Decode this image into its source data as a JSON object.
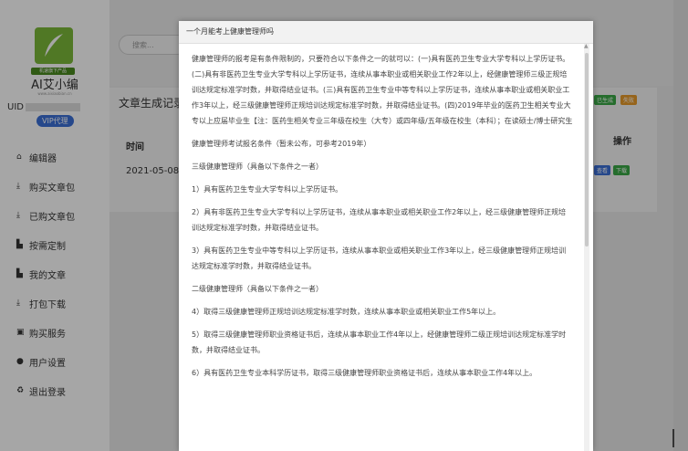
{
  "brand": {
    "name": "AI艾小编",
    "tagline": "机速旗下产品",
    "url": "www.aixiaobian.cn",
    "uid_label": "UID",
    "vip_badge": "VIP代理"
  },
  "search": {
    "placeholder": "搜索..."
  },
  "nav": [
    {
      "label": "编辑器",
      "icon": "home-icon"
    },
    {
      "label": "购买文章包",
      "icon": "download-icon"
    },
    {
      "label": "已购文章包",
      "icon": "download-icon"
    },
    {
      "label": "按需定制",
      "icon": "file-icon"
    },
    {
      "label": "我的文章",
      "icon": "file-icon"
    },
    {
      "label": "打包下载",
      "icon": "download-icon"
    },
    {
      "label": "购买服务",
      "icon": "service-icon"
    },
    {
      "label": "用户设置",
      "icon": "user-icon"
    },
    {
      "label": "退出登录",
      "icon": "logout-icon"
    }
  ],
  "records": {
    "title": "文章生成记录",
    "col_time": "时间",
    "col_ops": "操作",
    "row_time": "2021-05-08 18",
    "status_generated": "已生成",
    "status_failed": "失败",
    "view_label": "查看",
    "download_label": "下载"
  },
  "modal": {
    "title": "一个月能考上健康管理师吗",
    "paragraphs": [
      "健康管理师的报考是有条件限制的，只要符合以下条件之一的就可以：(一)具有医药卫生专业大学专科以上学历证书。(二)具有非医药卫生专业大学专科以上学历证书，连续从事本职业或相关职业工作2年以上，经健康管理师三级正规培训达规定标准学时数，并取得结业证书。(三)具有医药卫生专业中等专科以上学历证书，连续从事本职业或相关职业工作3年以上，经三级健康管理师正规培训达规定标准学时数，并取得结业证书。(四)2019年毕业的医药卫生相关专业大专以上应届毕业生【注：医药生相关专业三年级在校生（大专）或四年级/五年级在校生（本科）；在读硕士/博士研究生",
      "健康管理师考试报名条件（暂未公布，可参考2019年）",
      "三级健康管理师（具备以下条件之一者）",
      "1）具有医药卫生专业大学专科以上学历证书。",
      "2）具有非医药卫生专业大学专科以上学历证书，连续从事本职业或相关职业工作2年以上，经三级健康管理师正规培训达规定标准学时数，并取得结业证书。",
      "3）具有医药卫生专业中等专科以上学历证书，连续从事本职业或相关职业工作3年以上，经三级健康管理师正规培训达规定标准学时数，并取得结业证书。",
      "二级健康管理师（具备以下条件之一者）",
      "4）取得三级健康管理师正规培训达规定标准学时数，连续从事本职业或相关职业工作5年以上。",
      "5）取得三级健康管理师职业资格证书后，连续从事本职业工作4年以上，经健康管理师二级正规培训达规定标准学时数，并取得结业证书。",
      "6）具有医药卫生专业本科学历证书，取得三级健康管理师职业资格证书后，连续从事本职业工作4年以上。"
    ]
  }
}
